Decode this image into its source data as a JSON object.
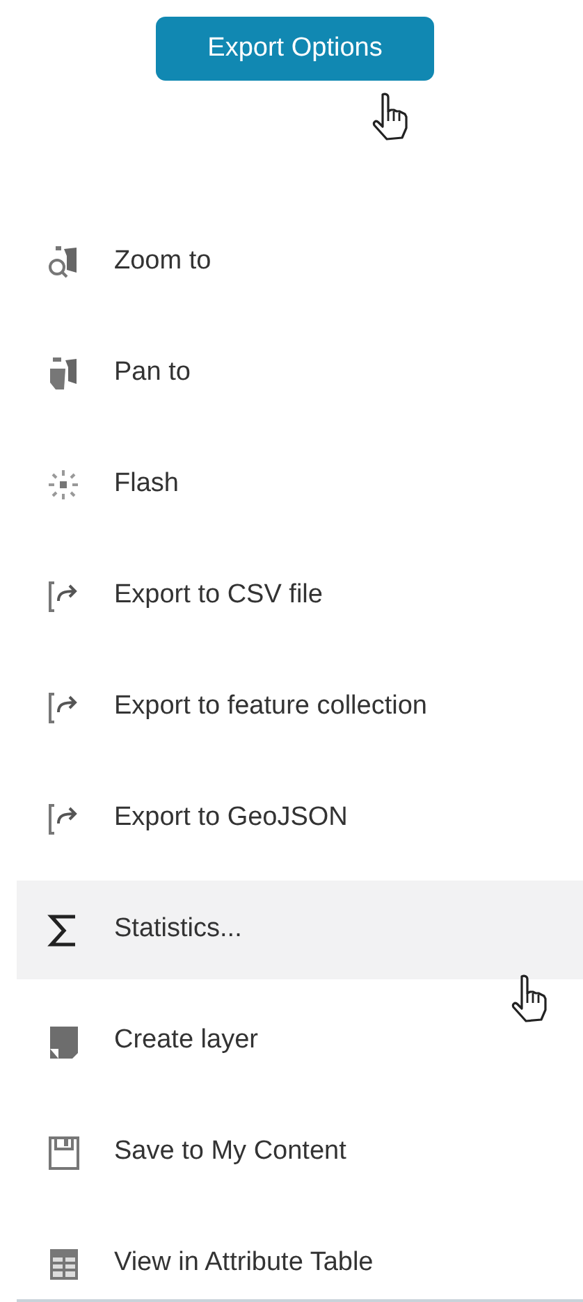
{
  "export_button": {
    "label": "Export Options"
  },
  "menu": [
    {
      "kind": "zoom",
      "label": "Zoom to",
      "highlighted": false
    },
    {
      "kind": "pan",
      "label": "Pan to",
      "highlighted": false
    },
    {
      "kind": "flash",
      "label": "Flash",
      "highlighted": false
    },
    {
      "kind": "export",
      "label": "Export to CSV file",
      "highlighted": false
    },
    {
      "kind": "export",
      "label": "Export to feature collection",
      "highlighted": false
    },
    {
      "kind": "export",
      "label": "Export to GeoJSON",
      "highlighted": false
    },
    {
      "kind": "statistics",
      "label": "Statistics...",
      "highlighted": true
    },
    {
      "kind": "layer",
      "label": "Create layer",
      "highlighted": false
    },
    {
      "kind": "save",
      "label": "Save to My Content",
      "highlighted": false
    },
    {
      "kind": "table",
      "label": "View in Attribute Table",
      "highlighted": false
    }
  ]
}
